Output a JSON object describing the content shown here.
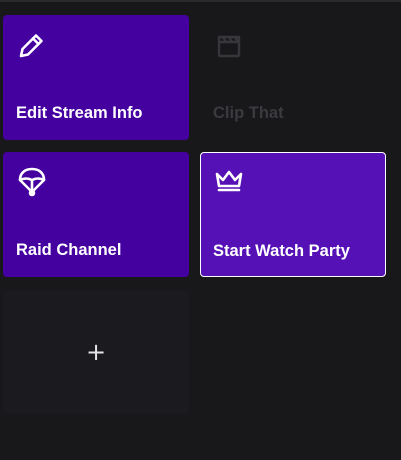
{
  "quick_actions": {
    "tiles": [
      {
        "label": "Edit Stream Info",
        "icon": "pencil-icon",
        "enabled": true
      },
      {
        "label": "Clip That",
        "icon": "clapperboard-icon",
        "enabled": false
      },
      {
        "label": "Raid Channel",
        "icon": "parachute-icon",
        "enabled": true
      },
      {
        "label": "Start Watch Party",
        "icon": "crown-icon",
        "enabled": true,
        "focused": true
      }
    ],
    "add_label": "+"
  },
  "colors": {
    "background": "#18181b",
    "tile_purple": "#4500a0",
    "tile_purple_focused": "#5511b5",
    "disabled_text": "#3a3a3f",
    "focus_border": "#ffffff"
  }
}
